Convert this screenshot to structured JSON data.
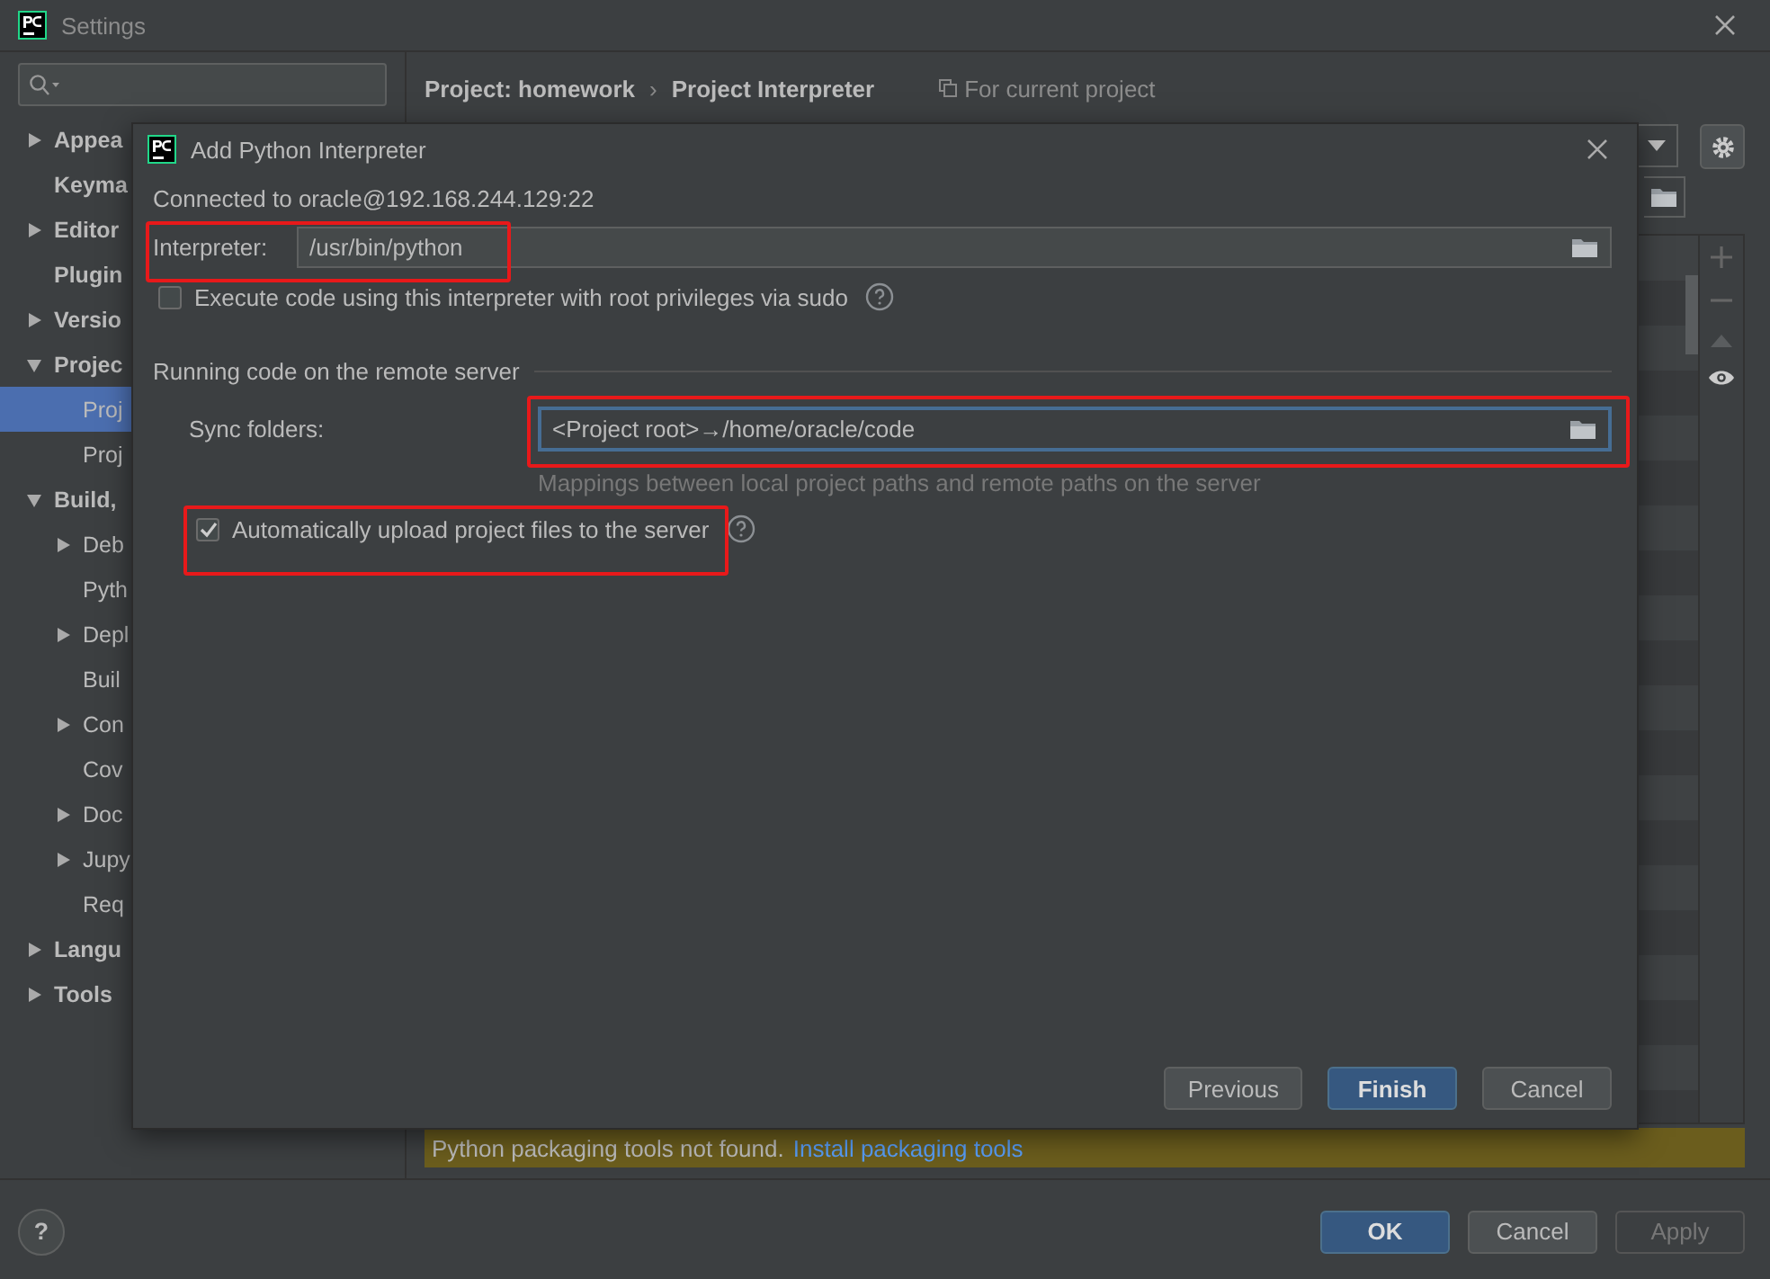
{
  "window": {
    "title": "Settings"
  },
  "sidebar": {
    "items": [
      {
        "label": "Appea",
        "kind": "collapsed",
        "selected": false
      },
      {
        "label": "Keyma",
        "kind": "leaf",
        "selected": false
      },
      {
        "label": "Editor",
        "kind": "collapsed",
        "selected": false
      },
      {
        "label": "Plugin",
        "kind": "leaf",
        "selected": false
      },
      {
        "label": "Versio",
        "kind": "collapsed",
        "selected": false
      },
      {
        "label": "Projec",
        "kind": "expanded",
        "selected": false,
        "children": [
          {
            "label": "Proj",
            "kind": "leaf",
            "selected": true
          },
          {
            "label": "Proj",
            "kind": "leaf",
            "selected": false
          }
        ]
      },
      {
        "label": "Build,",
        "kind": "expanded",
        "selected": false,
        "children": [
          {
            "label": "Deb",
            "kind": "collapsed",
            "selected": false
          },
          {
            "label": "Pyth",
            "kind": "leaf",
            "selected": false
          },
          {
            "label": "Depl",
            "kind": "collapsed",
            "selected": false
          },
          {
            "label": "Buil",
            "kind": "leaf",
            "selected": false
          },
          {
            "label": "Con",
            "kind": "collapsed",
            "selected": false
          },
          {
            "label": "Cov",
            "kind": "leaf",
            "selected": false
          },
          {
            "label": "Doc",
            "kind": "collapsed",
            "selected": false
          },
          {
            "label": "Jupy",
            "kind": "collapsed",
            "selected": false
          },
          {
            "label": "Req",
            "kind": "leaf",
            "selected": false
          }
        ]
      },
      {
        "label": "Langu",
        "kind": "collapsed",
        "selected": false
      },
      {
        "label": "Tools",
        "kind": "collapsed",
        "selected": false
      }
    ]
  },
  "breadcrumb": [
    "Project: homework",
    "Project Interpreter"
  ],
  "breadcrumb_separator": "›",
  "help_button": "?",
  "scope_note": "For current project",
  "warning": {
    "text": "Python packaging tools not found.",
    "link": "Install packaging tools"
  },
  "footer_buttons": [
    {
      "label": "OK",
      "kind": "primary"
    },
    {
      "label": "Cancel",
      "kind": "normal"
    },
    {
      "label": "Apply",
      "kind": "disabled"
    }
  ],
  "dialog": {
    "title": "Add Python Interpreter",
    "connection": "Connected to oracle@192.168.244.129:22",
    "interpreter": {
      "label": "Interpreter:",
      "value": "/usr/bin/python"
    },
    "sudo": {
      "label": "Execute code using this interpreter with root privileges via sudo",
      "checked": false
    },
    "section": "Running code on the remote server",
    "sync": {
      "label": "Sync folders:",
      "value": "<Project root>→/home/oracle/code",
      "hint": "Mappings between local project paths and remote paths on the server"
    },
    "upload": {
      "label": "Automatically upload project files to the server",
      "checked": true
    },
    "buttons": [
      {
        "label": "Previous",
        "default": false
      },
      {
        "label": "Finish",
        "default": true
      },
      {
        "label": "Cancel",
        "default": false
      }
    ]
  }
}
